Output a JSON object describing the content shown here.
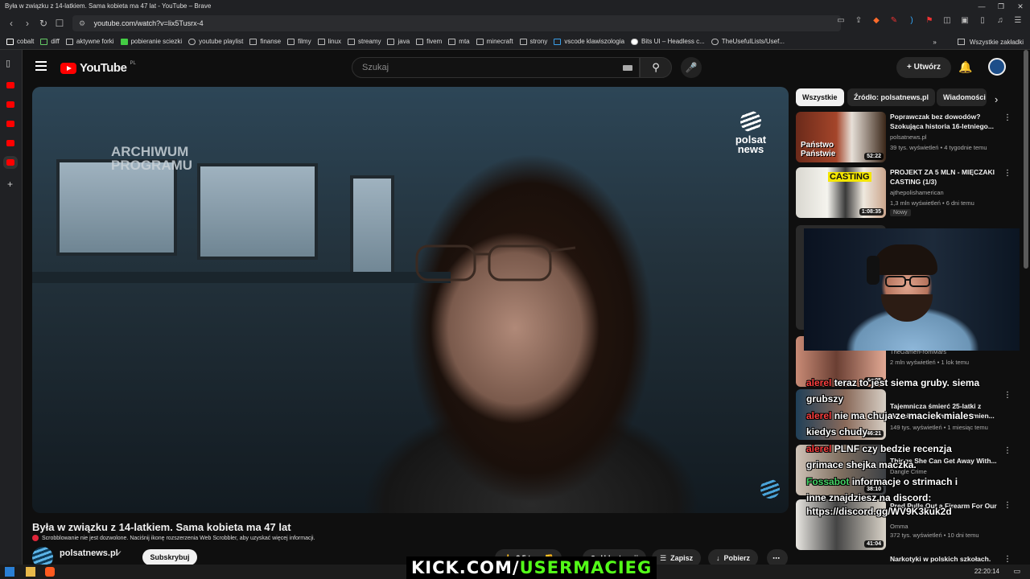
{
  "browser": {
    "window_title": "Była w związku z 14-latkiem. Sama kobieta ma 47 lat - YouTube – Brave",
    "url": "youtube.com/watch?v=lix5Tusrx-4",
    "shield_count": "57",
    "bookmarks": [
      "cobalt",
      "diff",
      "aktywne forki",
      "pobieranie sciezki",
      "youtube playlist",
      "finanse",
      "filmy",
      "linux",
      "streamy",
      "java",
      "fivem",
      "mta",
      "minecraft",
      "strony",
      "vscode klawiszologia",
      "Bits UI – Headless c...",
      "TheUsefulLists/Usef..."
    ],
    "bookmarks_more": "»",
    "all_bookmarks": "Wszystkie zakładki"
  },
  "youtube": {
    "logo": "YouTube",
    "country": "PL",
    "search_placeholder": "Szukaj",
    "create_label": "Utwórz",
    "create_plus": "+",
    "search_icon": "⚲",
    "mic_icon": "🎤",
    "bell_icon": "🔔"
  },
  "video": {
    "overlay_archive": "ARCHIWUM PROGRAMU",
    "overlay_brand": "polsat news",
    "title": "Była w związku z 14-latkiem. Sama kobieta ma 47 lat",
    "scrobbler_notice": "Scrobblowanie nie jest dozwolone. Naciśnij ikonę rozszerzenia Web Scrobbler, aby uzyskać więcej informacji.",
    "channel_name": "polsatnews.pl",
    "subscribe_label": "Subskrybuj",
    "actions": {
      "like": "2,5 tys.",
      "share": "Udostępnij",
      "save": "Zapisz",
      "download": "Pobierz",
      "more": "⋯"
    }
  },
  "chips": [
    "Wszystkie",
    "Źródło: polsatnews.pl",
    "Wiadomości"
  ],
  "recommendations": [
    {
      "title": "Poprawczak bez dowodów? Szokująca historia 16-letniego...",
      "channel": "polsatnews.pl",
      "meta": "39 tys. wyświetleń • 4 tygodnie temu",
      "duration": "52:22"
    },
    {
      "title": "PROJEKT ZA 5 MLN - MIĘCZAKI CASTING (1/3)",
      "channel": "ajthepolishamerican",
      "meta": "1,3 mln wyświetleń • 6 dni temu",
      "duration": "1:08:35",
      "badge": "Nowy"
    },
    {
      "title": "TheGamerFromMars",
      "channel": "",
      "meta": "2 mln wyświetleń • 1 lok temu",
      "duration": "44:05"
    },
    {
      "title": "Tajemnicza śmierć 25-latki z Wrocławia. Ekshumacja zmien...",
      "channel": "polsatnews.pl",
      "meta": "149 tys. wyświetleń • 1 miesiąc temu",
      "duration": "46:21"
    },
    {
      "title": "Things She Can Get Away With...",
      "channel": "Dangle Crime",
      "meta": "",
      "duration": "38:10"
    },
    {
      "title": "Pred Pulls Out a Firearm For Our",
      "channel": "Omma",
      "meta": "372 tys. wyświetleń • 10 dni temu",
      "duration": "41:04"
    },
    {
      "title": "Narkotyki w polskich szkołach.",
      "channel": "",
      "meta": "",
      "duration": ""
    }
  ],
  "stream_overlay": {
    "chat": [
      {
        "user": "alerel",
        "text": "teraz to jest siema gruby. siema"
      },
      {
        "user": "",
        "text": "grubszy"
      },
      {
        "user": "alerel",
        "text": "nie ma chuja ze maciek miales"
      },
      {
        "user": "",
        "text": "kiedys chudy"
      },
      {
        "user": "alerel",
        "text": "PLNF czy bedzie recenzja"
      },
      {
        "user": "",
        "text": "grimace shejka maczka."
      },
      {
        "user": "Fossabot",
        "text": "informacje o strimach i"
      },
      {
        "user": "",
        "text": "inne znajdziesz na discord:"
      },
      {
        "user": "",
        "text": "https://discord.gg/WV9K3kuk2d"
      }
    ],
    "kick_prefix": "KICK.COM/",
    "kick_user": "USERMACIEG"
  },
  "taskbar": {
    "clock": "22:20:14"
  }
}
